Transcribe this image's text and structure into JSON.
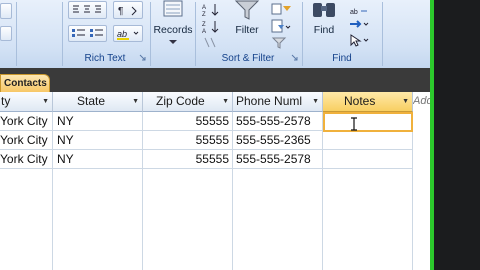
{
  "ribbon": {
    "groups": [
      {
        "label": "Rich Text"
      },
      {
        "label": "Sort & Filter"
      },
      {
        "label": "Find"
      }
    ],
    "buttons": {
      "records": "Records",
      "filter": "Filter",
      "find": "Find"
    }
  },
  "tab": {
    "label": "Contacts"
  },
  "table": {
    "columns": [
      {
        "label": "ty"
      },
      {
        "label": "State"
      },
      {
        "label": "Zip Code"
      },
      {
        "label": "Phone Numl"
      },
      {
        "label": "Notes"
      }
    ],
    "add_new": "Add New F",
    "rows": [
      {
        "city": "York City",
        "state": "NY",
        "zip": "55555",
        "phone": "555-555-2578",
        "notes": ""
      },
      {
        "city": "York City",
        "state": "NY",
        "zip": "55555",
        "phone": "555-555-2365",
        "notes": ""
      },
      {
        "city": "York City",
        "state": "NY",
        "zip": "55555",
        "phone": "555-555-2578",
        "notes": ""
      }
    ]
  },
  "colors": {
    "accent_active": "#f7c767",
    "ribbon_label": "#15428b",
    "side_bar": "#2cc92c"
  }
}
